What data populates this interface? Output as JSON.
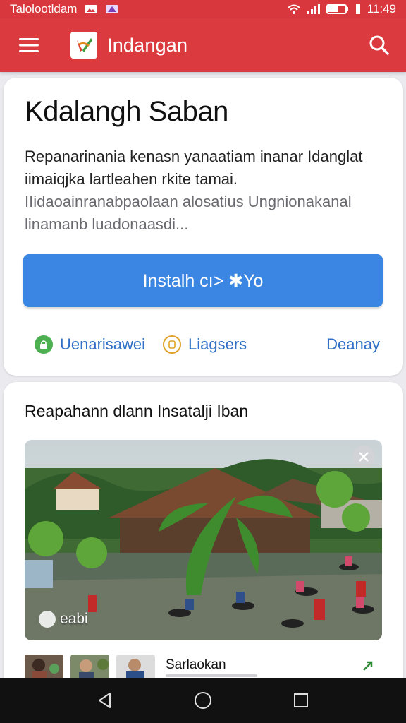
{
  "status_bar": {
    "carrier": "Talolootldam",
    "time": "11:49",
    "icons": [
      "photo-icon",
      "gallery-icon",
      "wifi-icon",
      "signal-icon",
      "battery-icon",
      "charging-icon"
    ]
  },
  "app_bar": {
    "title": "Indangan",
    "menu_icon": "menu-icon",
    "search_icon": "search-icon",
    "colors": {
      "bar": "#db3a3f",
      "status": "#d8383d"
    }
  },
  "app_card": {
    "title": "Kdalangh Saban",
    "description": "Repanarinania kenasn yanaatiam inanar Idanglat iimaiqjka lartleahen rkite tamai.",
    "description_secondary": "IIidaoainranabpaolaan alosatius Ungnionakanal linamanb luadonaasdi...",
    "install_label": "Instalh cı> ✱Yo",
    "install_color": "#3b86e3",
    "links": {
      "first": "Uenarisawei",
      "second": "Liagsers",
      "third": "Deanay"
    }
  },
  "section": {
    "title": "Reapahann dlann Insatalji Iban",
    "photo_caption": "eabi",
    "recent_title": "Sarlaokan"
  },
  "nav_bar": {
    "icons": [
      "back-icon",
      "home-icon",
      "recents-icon"
    ]
  }
}
